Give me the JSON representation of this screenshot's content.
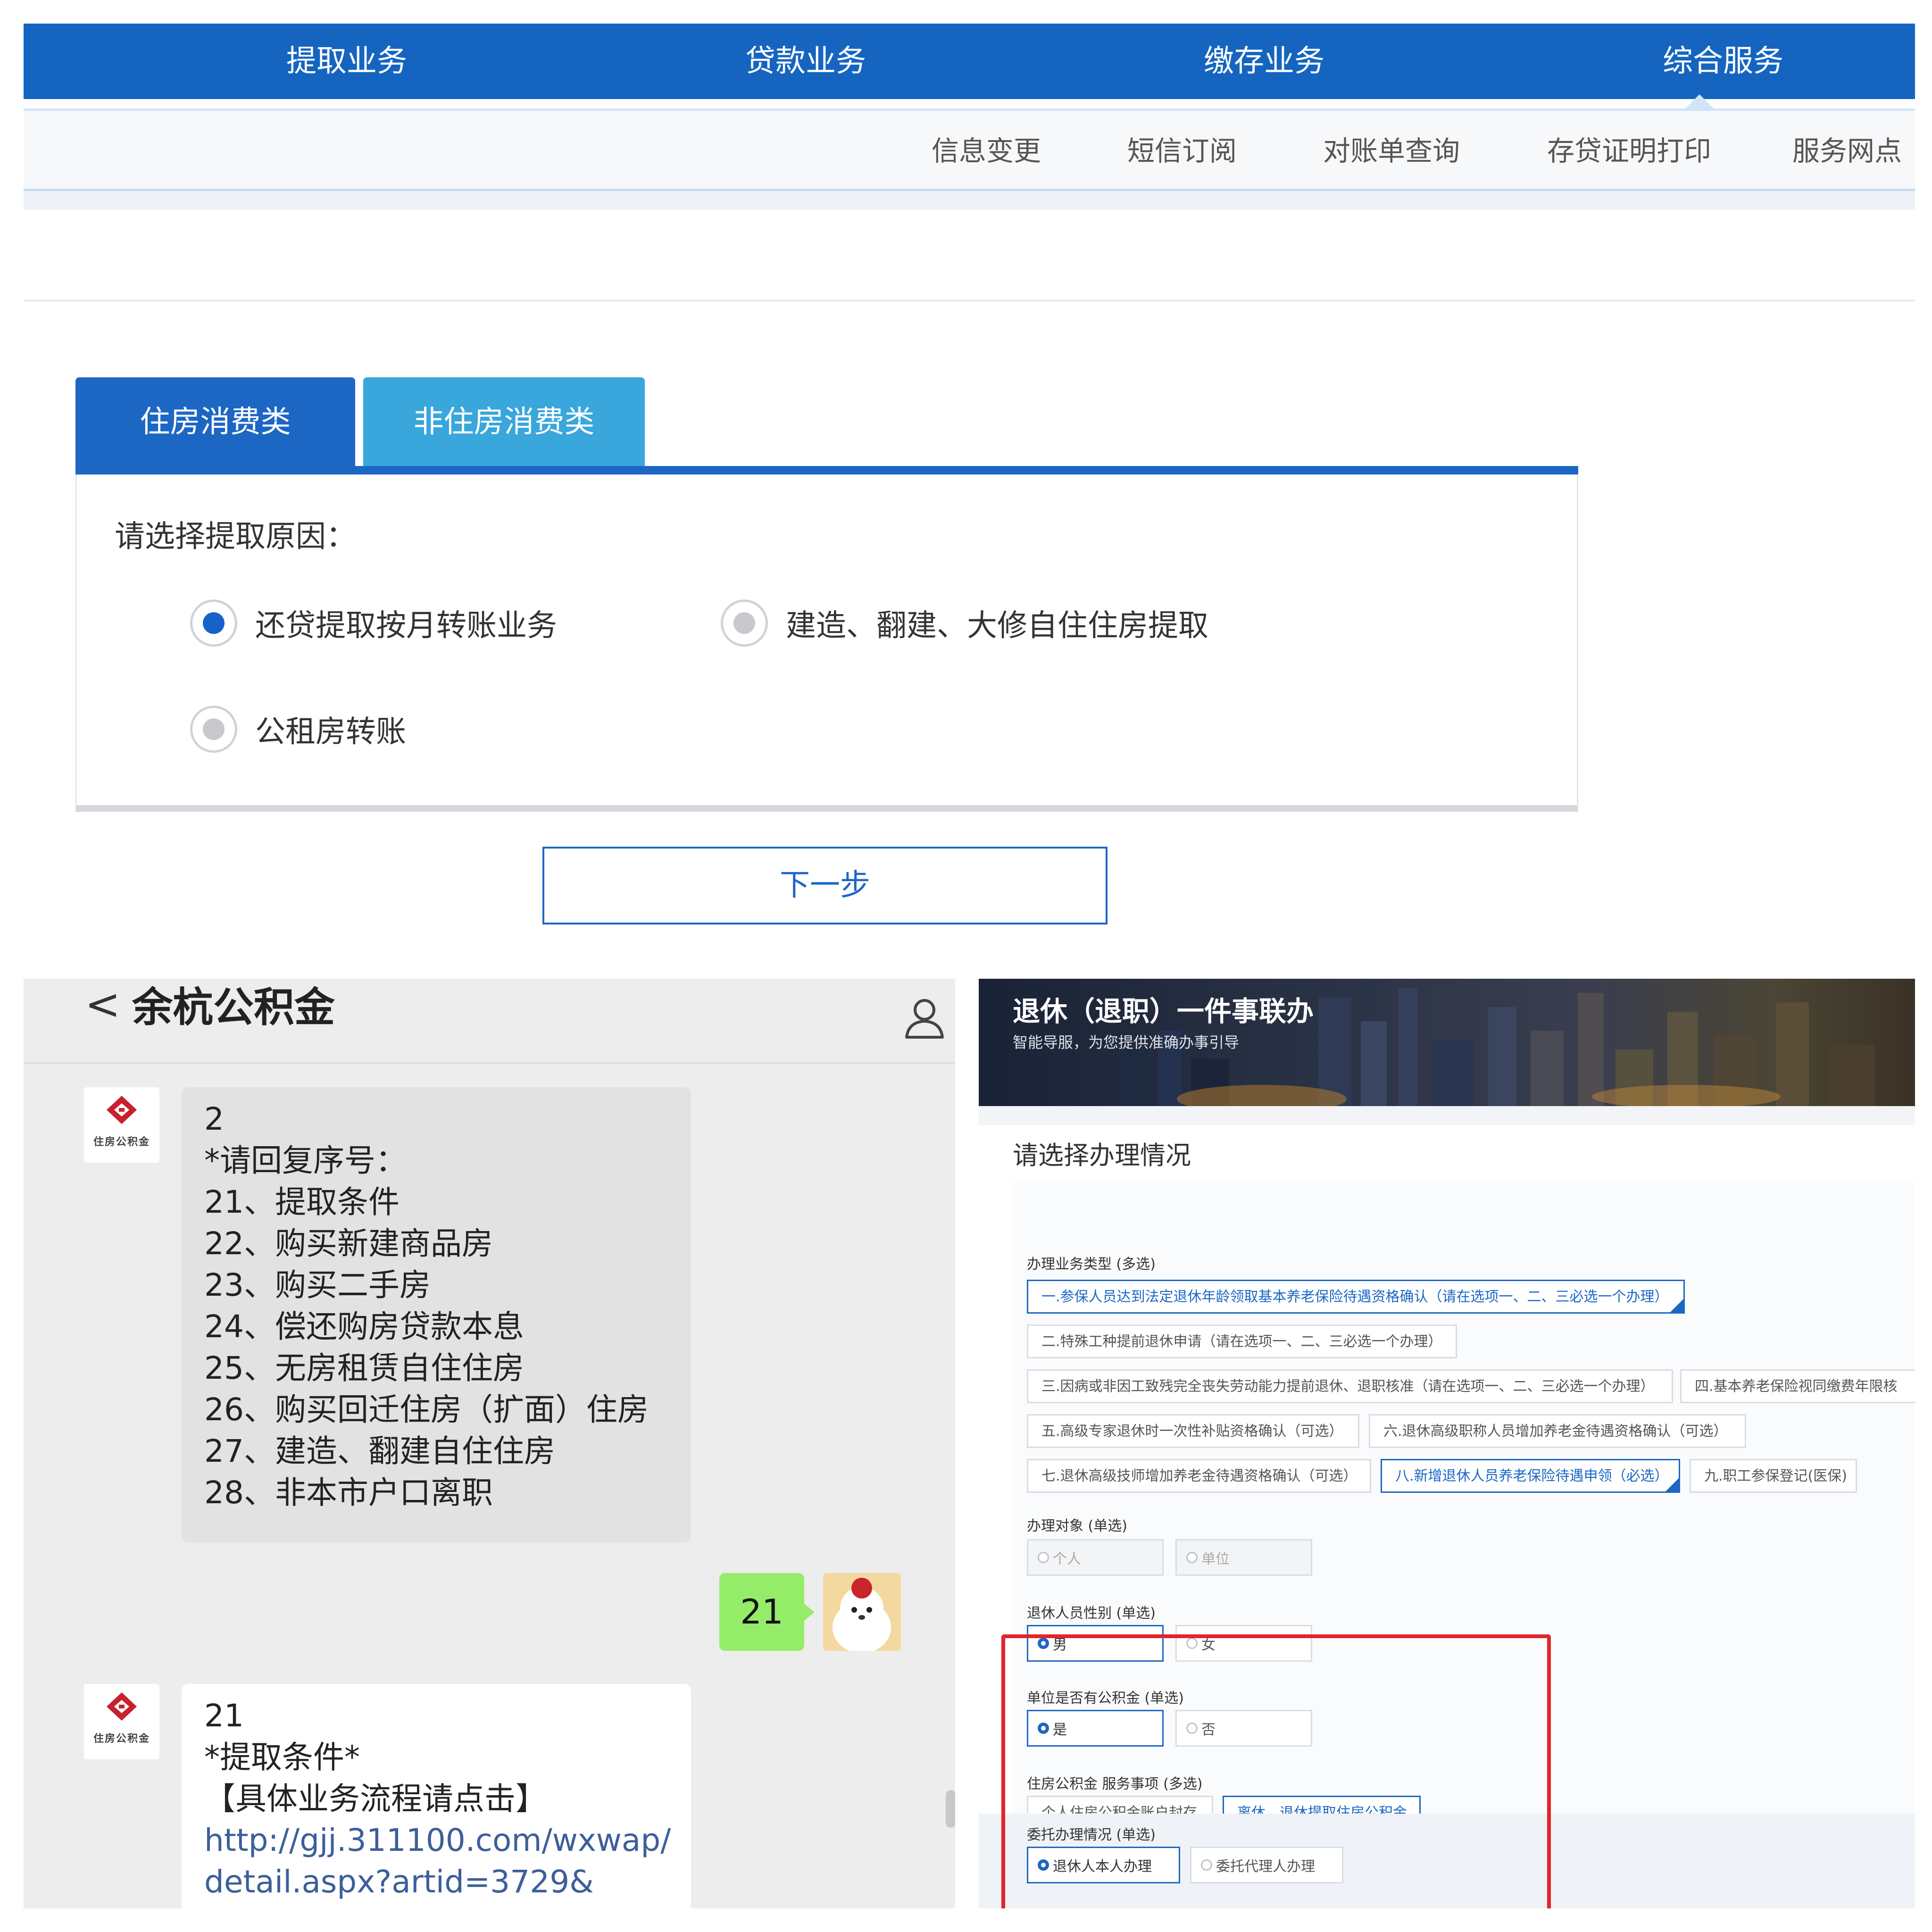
{
  "top": {
    "nav": [
      "提取业务",
      "贷款业务",
      "缴存业务",
      "综合服务"
    ],
    "subnav": [
      "信息变更",
      "短信订阅",
      "对账单查询",
      "存贷证明打印",
      "服务网点"
    ],
    "tabs": [
      "住房消费类",
      "非住房消费类"
    ],
    "prompt": "请选择提取原因：",
    "options": [
      "还贷提取按月转账业务",
      "建造、翻建、大修自住住房提取",
      "公租房转账"
    ],
    "selected_option": 0,
    "next_button": "下一步",
    "colors": {
      "primary": "#1d67c4",
      "tab_inactive": "#39a6dc"
    }
  },
  "chat": {
    "title": "余杭公积金",
    "back_glyph": "<",
    "logo_text": "住房公积金",
    "message1": {
      "lines": [
        "2",
        "*请回复序号：",
        "21、提取条件",
        "22、购买新建商品房",
        "23、购买二手房",
        "24、偿还购房贷款本息",
        "25、无房租赁自住住房",
        "26、购买回迁住房（扩面）住房",
        "27、建造、翻建自住住房",
        "28、非本市户口离职"
      ]
    },
    "sent_message": "21",
    "message2": {
      "lines": [
        "21",
        "*提取条件*",
        "【具体业务流程请点击】"
      ],
      "link_lines": [
        "http://gjj.311100.com/wxwap/",
        "detail.aspx?artid=3729&"
      ]
    },
    "colors": {
      "sent_bubble": "#95ec69",
      "background": "#ededed"
    }
  },
  "retire": {
    "banner_title": "退休（退职）一件事联办",
    "banner_subtitle": "智能导服，为您提供准确办事引导",
    "section_title": "请选择办理情况",
    "business_type": {
      "label": "办理业务类型 (多选)",
      "items": [
        "一.参保人员达到法定退休年龄领取基本养老保险待遇资格确认（请在选项一、二、三必选一个办理）",
        "二.特殊工种提前退休申请（请在选项一、二、三必选一个办理）",
        "三.因病或非因工致残完全丧失劳动能力提前退休、退职核准（请在选项一、二、三必选一个办理）",
        "四.基本养老保险视同缴费年限核",
        "五.高级专家退休时一次性补贴资格确认（可选）",
        "六.退休高级职称人员增加养老金待遇资格确认（可选）",
        "七.退休高级技师增加养老金待遇资格确认（可选）",
        "八.新增退休人员养老保险待遇申领（必选）",
        "九.职工参保登记(医保)"
      ],
      "selected": [
        0,
        7
      ]
    },
    "target": {
      "label": "办理对象 (单选)",
      "options": [
        "个人",
        "单位"
      ]
    },
    "gender": {
      "label": "退休人员性别 (单选)",
      "options": [
        "男",
        "女"
      ]
    },
    "has_fund": {
      "label": "单位是否有公积金 (单选)",
      "options": [
        "是",
        "否"
      ]
    },
    "fund_service": {
      "label": "住房公积金 服务事项 (多选)",
      "items": [
        "个人住房公积金账户封存",
        "离休、退休提取住房公积金"
      ],
      "selected": [
        1
      ]
    },
    "entrust": {
      "label": "委托办理情况 (单选)",
      "options": [
        "退休人本人办理",
        "委托代理人办理"
      ]
    },
    "colors": {
      "highlight": "#e0262b",
      "selected_border": "#1d67c4"
    }
  }
}
